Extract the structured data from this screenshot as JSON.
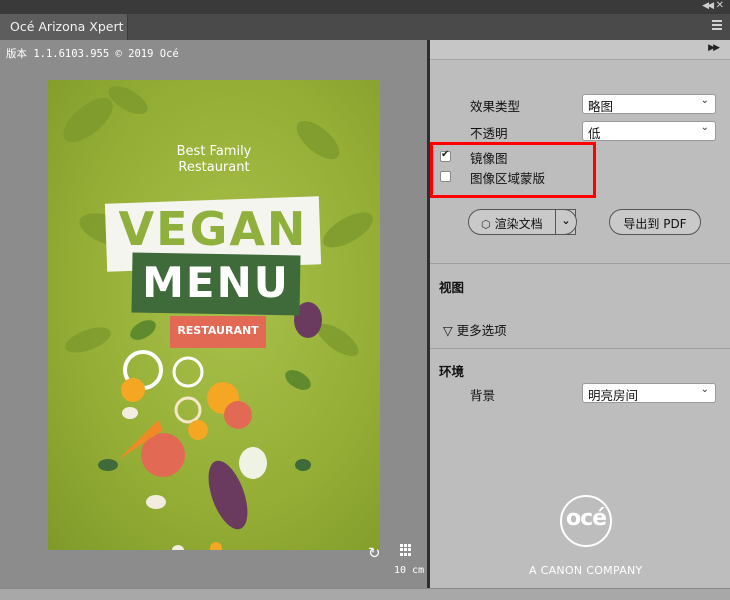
{
  "app": {
    "tab_title": "Océ Arizona Xpert"
  },
  "preview": {
    "version_text": "版本 1.1.6103.955 © 2019 Océ",
    "scale_text": "10 cm",
    "poster": {
      "line1": "Best Family",
      "line2": "Restaurant",
      "title1": "VEGAN",
      "title2": "MENU",
      "tag": "RESTAURANT"
    }
  },
  "panel": {
    "effect_type_label": "效果类型",
    "effect_type_value": "略图",
    "opacity_label": "不透明",
    "opacity_value": "低",
    "mirror_label": "镜像图",
    "mirror_checked": true,
    "mask_label": "图像区域蒙版",
    "mask_checked": false,
    "render_label": "渲染文档",
    "export_label": "导出到 PDF",
    "view_section": "视图",
    "more_options": "▽ 更多选项",
    "env_section": "环境",
    "background_label": "背景",
    "background_value": "明亮房间"
  },
  "brand": {
    "logo_text": "océ",
    "tagline": "A CANON COMPANY"
  },
  "colors": {
    "highlight": "#ff0000",
    "poster_green": "#93ad35"
  }
}
